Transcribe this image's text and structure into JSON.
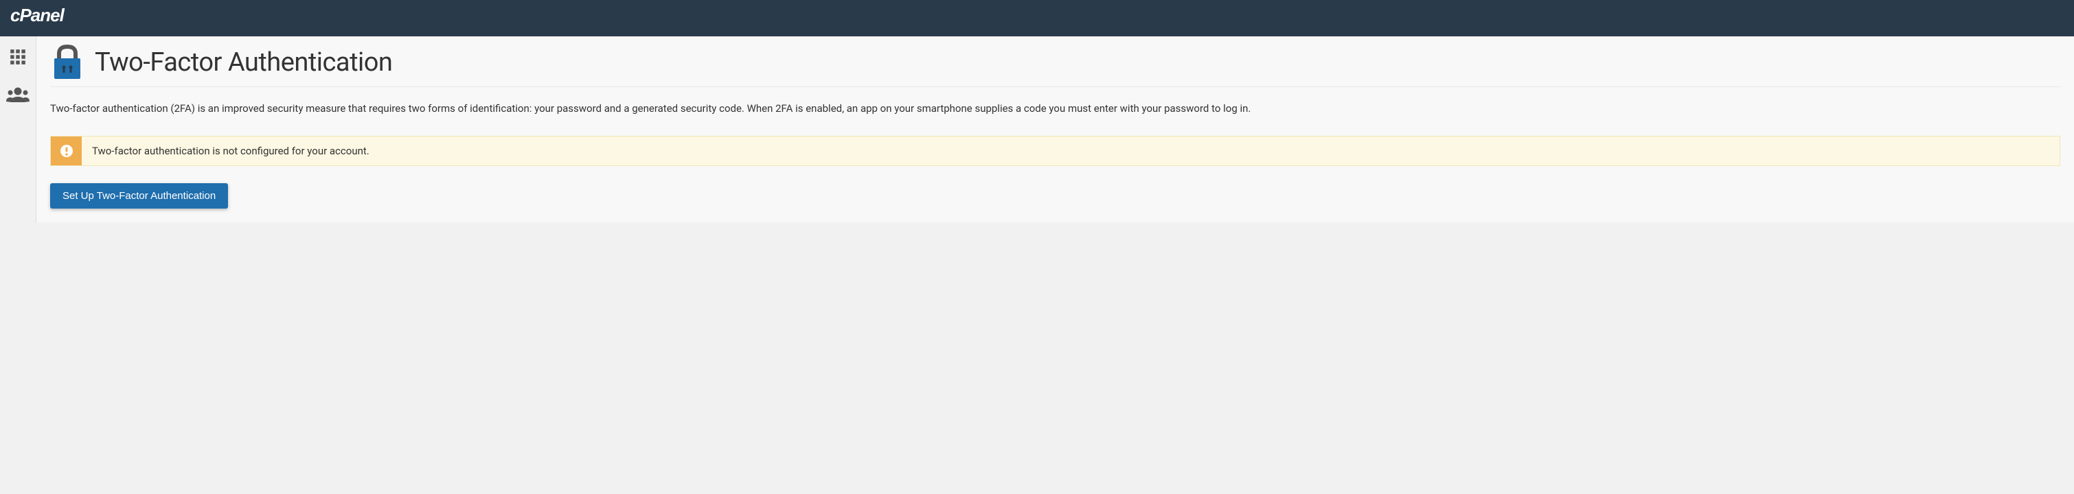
{
  "header": {
    "brand": "cPanel"
  },
  "page": {
    "title": "Two-Factor Authentication",
    "description": "Two-factor authentication (2FA) is an improved security measure that requires two forms of identification: your password and a generated security code. When 2FA is enabled, an app on your smartphone supplies a code you must enter with your password to log in."
  },
  "alert": {
    "message": "Two-factor authentication is not configured for your account."
  },
  "actions": {
    "setup_label": "Set Up Two-Factor Authentication"
  }
}
